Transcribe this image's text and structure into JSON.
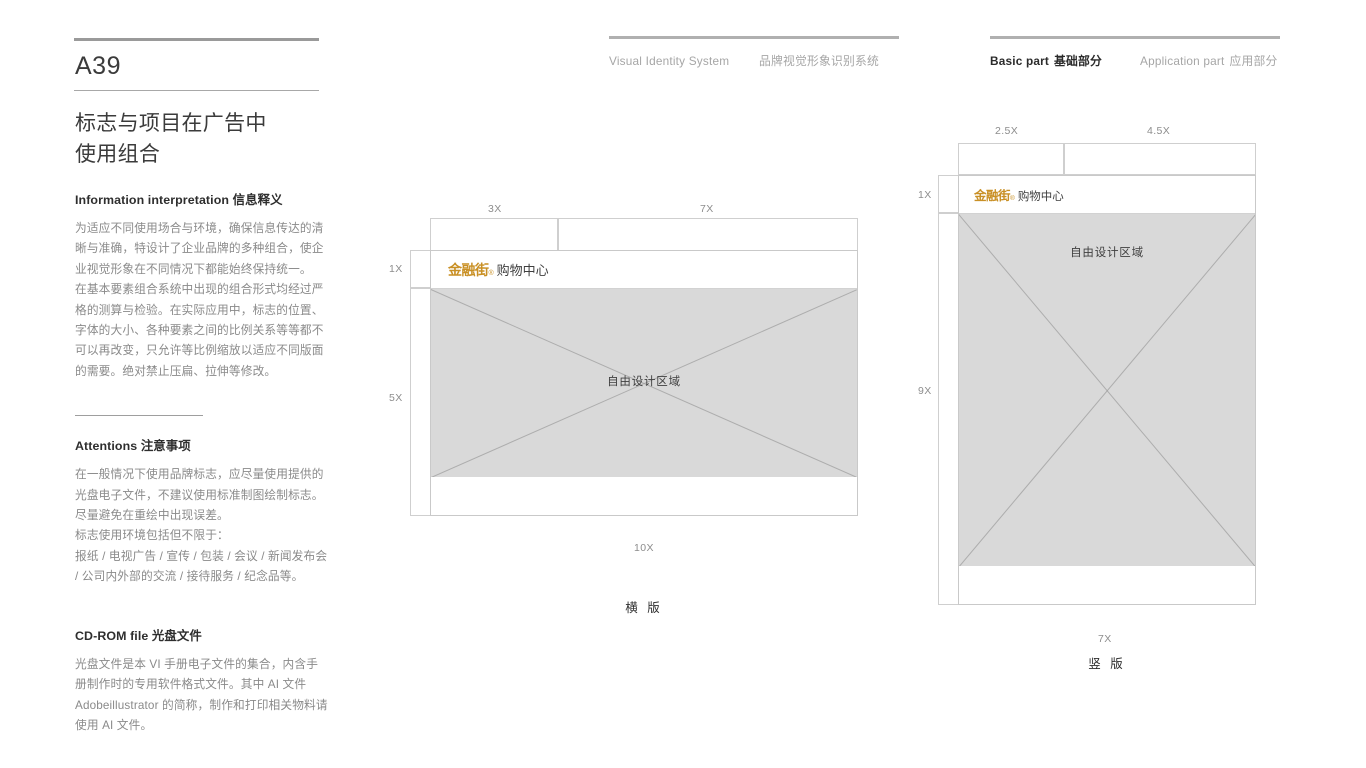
{
  "left": {
    "page_code": "A39",
    "page_title_line1": "标志与项目在广告中",
    "page_title_line2": "使用组合",
    "section1": {
      "heading_en": "Information interpretation",
      "heading_cn": "信息释义",
      "paragraph1": "为适应不同使用场合与环境，确保信息传达的清晰与准确，特设计了企业品牌的多种组合，使企业视觉形象在不同情况下都能始终保持统一。",
      "paragraph2": "在基本要素组合系统中出现的组合形式均经过严格的测算与检验。在实际应用中，标志的位置、字体的大小、各种要素之间的比例关系等等都不可以再改变，只允许等比例缩放以适应不同版面的需要。绝对禁止压扁、拉伸等修改。"
    },
    "section2": {
      "heading_en": "Attentions",
      "heading_cn": "注意事项",
      "paragraph1": "在一般情况下使用品牌标志，应尽量使用提供的光盘电子文件，不建议使用标准制图绘制标志。尽量避免在重绘中出现误差。",
      "paragraph2": "标志使用环境包括但不限于：",
      "paragraph3": "报纸 / 电视广告 / 宣传 / 包装 / 会议 / 新闻发布会 / 公司内外部的交流 / 接待服务 / 纪念品等。"
    },
    "section3": {
      "heading_en": "CD-ROM file",
      "heading_cn": "光盘文件",
      "paragraph1": "光盘文件是本 VI 手册电子文件的集合，内含手册制作时的专用软件格式文件。其中 AI 文件 Adobeillustrator 的简称，制作和打印相关物料请使用 AI 文件。"
    }
  },
  "header": {
    "group_left": [
      {
        "en": "Visual Identity System",
        "cn": "",
        "active": false
      },
      {
        "en": "",
        "cn": "品牌视觉形象识别系统",
        "active": false
      }
    ],
    "group_right": [
      {
        "en": "Basic part",
        "cn": "基础部分",
        "active": true
      },
      {
        "en": "Application part",
        "cn": "应用部分",
        "active": false
      }
    ]
  },
  "logo": {
    "mark": "金融街",
    "registered": "®",
    "sub": "购物中心",
    "color": "#c99025"
  },
  "diagrams": [
    {
      "id": "horizontal",
      "caption": "横 版",
      "design_area_label": "自由设计区域",
      "dims": {
        "top_left": "3X",
        "top_right": "7X",
        "left_top": "1X",
        "left_bottom": "5X",
        "bottom": "10X"
      }
    },
    {
      "id": "vertical",
      "caption": "竖 版",
      "design_area_label": "自由设计区域",
      "dims": {
        "top_left": "2.5X",
        "top_right": "4.5X",
        "left_top": "1X",
        "left_bottom": "9X",
        "bottom": "7X"
      }
    }
  ],
  "colors": {
    "brand_gold": "#c99025",
    "design_area_gray": "#d9d9d9",
    "rule_gray": "#9a9a9a"
  }
}
